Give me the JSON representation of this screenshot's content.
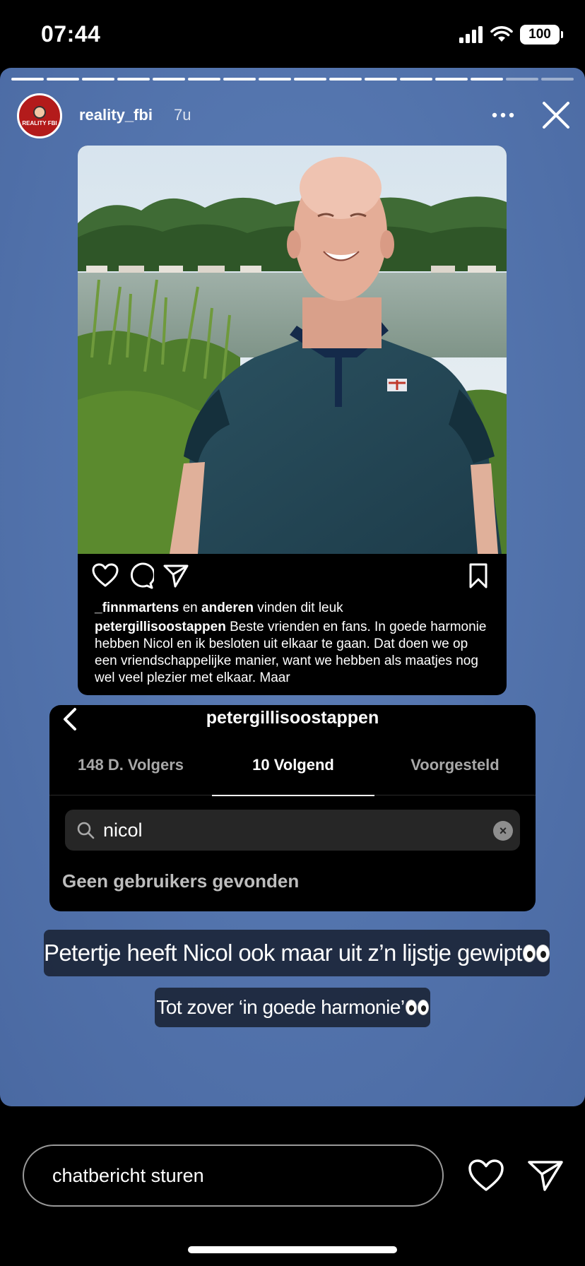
{
  "status_bar": {
    "time": "07:44",
    "battery": "100",
    "icons": [
      "signal-icon",
      "wifi-icon",
      "battery-icon"
    ]
  },
  "story": {
    "progress_total": 16,
    "progress_done": 14,
    "username": "reality_fbi",
    "time_ago": "7u",
    "avatar_text": "REALITY FBI",
    "background_color": "#5475ae"
  },
  "post": {
    "likes_user": "_finnmartens",
    "likes_connector": "en",
    "likes_others": "anderen",
    "likes_suffix": "vinden dit leuk",
    "caption_user": "petergillisoostappen",
    "caption_text": "Beste vrienden en fans. In goede harmonie hebben Nicol en ik besloten uit elkaar te gaan. Dat doen we op een vriendschappelijke manier, want we hebben als maatjes nog wel veel plezier met elkaar. Maar"
  },
  "following_panel": {
    "title": "petergillisoostappen",
    "tabs": [
      {
        "label": "148 D. Volgers",
        "active": false
      },
      {
        "label": "10 Volgend",
        "active": true
      },
      {
        "label": "Voorgesteld",
        "active": false
      }
    ],
    "search_value": "nicol",
    "empty_message": "Geen gebruikers gevonden"
  },
  "stickers": {
    "line1": "Petertje heeft Nicol ook maar uit z’n lijstje gewipt",
    "line2": "Tot zover ‘in goede harmonie’"
  },
  "reply": {
    "placeholder": "chatbericht sturen"
  }
}
